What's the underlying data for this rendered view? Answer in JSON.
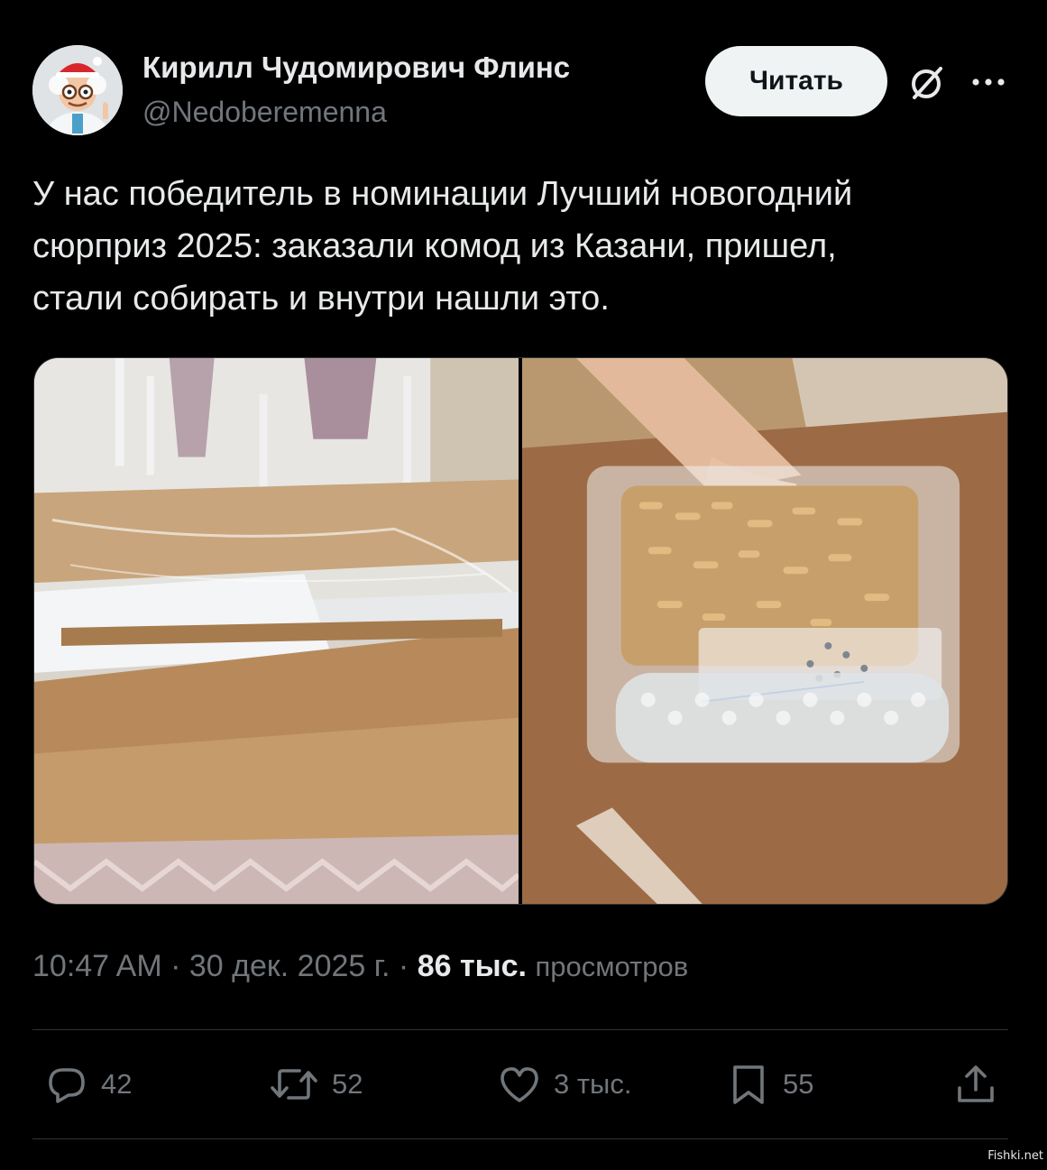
{
  "author": {
    "name": "Кирилл Чудомирович Флинс",
    "handle": "@Nedoberemenna"
  },
  "header": {
    "follow_label": "Читать",
    "icons": [
      "grok-icon",
      "more-icon"
    ]
  },
  "tweet": {
    "text": "У нас победитель в номинации Лучший новогодний\nсюрприз 2025: заказали комод из Казани, пришел,\nстали собирать и внутри нашли это."
  },
  "meta": {
    "time": "10:47 AM",
    "separator": "·",
    "date": "30 дек. 2025 г.",
    "views_count": "86 тыс.",
    "views_label": "просмотров"
  },
  "actions": {
    "replies": "42",
    "retweets": "52",
    "likes": "3 тыс.",
    "bookmarks": "55"
  },
  "colors": {
    "background": "#000000",
    "text_primary": "#e7e9ea",
    "text_secondary": "#71767b",
    "button_bg": "#eff3f4",
    "divider": "#2f3336"
  },
  "watermark": "Fishki.net"
}
